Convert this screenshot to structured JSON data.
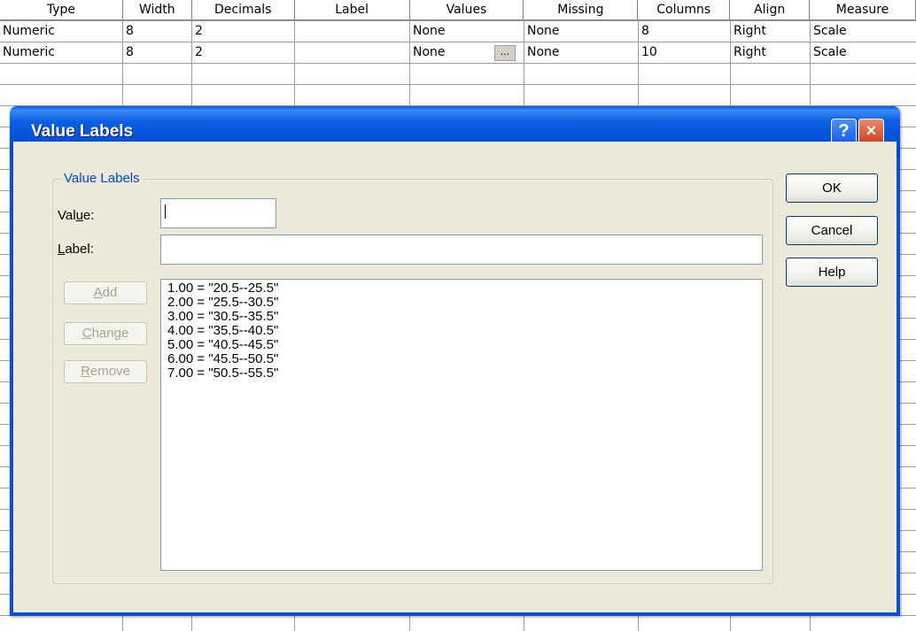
{
  "grid": {
    "columns": [
      "Type",
      "Width",
      "Decimals",
      "Label",
      "Values",
      "Missing",
      "Columns",
      "Align",
      "Measure"
    ],
    "rows": [
      {
        "type": "Numeric",
        "width": "8",
        "decimals": "2",
        "label": "",
        "values": "None",
        "missing": "None",
        "columns": "8",
        "align": "Right",
        "measure": "Scale"
      },
      {
        "type": "Numeric",
        "width": "8",
        "decimals": "2",
        "label": "",
        "values": "None",
        "missing": "None",
        "columns": "10",
        "align": "Right",
        "measure": "Scale"
      }
    ],
    "ellipsis_label": "..."
  },
  "dialog": {
    "title": "Value Labels",
    "help_icon": "?",
    "close_icon": "×",
    "group_label": "Value Labels",
    "value_label_pre": "Val",
    "value_label_u": "u",
    "value_label_post": "e:",
    "label_label_u": "L",
    "label_label_post": "abel:",
    "value_input": "",
    "label_input": "",
    "list_items": [
      "1.00 = \"20.5--25.5\"",
      "2.00 = \"25.5--30.5\"",
      "3.00 = \"30.5--35.5\"",
      "4.00 = \"35.5--40.5\"",
      "5.00 = \"40.5--45.5\"",
      "6.00 = \"45.5--50.5\"",
      "7.00 = \"50.5--55.5\""
    ],
    "add_u": "A",
    "add_post": "dd",
    "change_u": "C",
    "change_post": "hange",
    "remove_u": "R",
    "remove_post": "emove",
    "ok_label": "OK",
    "cancel_label": "Cancel",
    "help_label": "Help"
  },
  "colors": {
    "titlebar": "#0a5fe3",
    "dialog_face": "#ece9d8",
    "group_label": "#0046d5",
    "disabled_text": "#a7a691"
  }
}
